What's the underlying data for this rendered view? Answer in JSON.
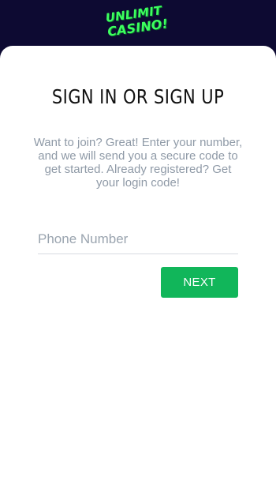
{
  "brand": {
    "logo_line1": "UNLIMIT",
    "logo_line2": "CASINO!",
    "accent_color": "#3dff5f",
    "header_bg": "#0d0a32"
  },
  "form": {
    "title": "SIGN IN OR SIGN UP",
    "description": "Want to join? Great! Enter your number, and we will send you a secure code to get started. Already registered? Get your login code!",
    "phone_value": "",
    "phone_placeholder": "Phone Number",
    "next_label": "NEXT",
    "button_color": "#11b65a"
  }
}
